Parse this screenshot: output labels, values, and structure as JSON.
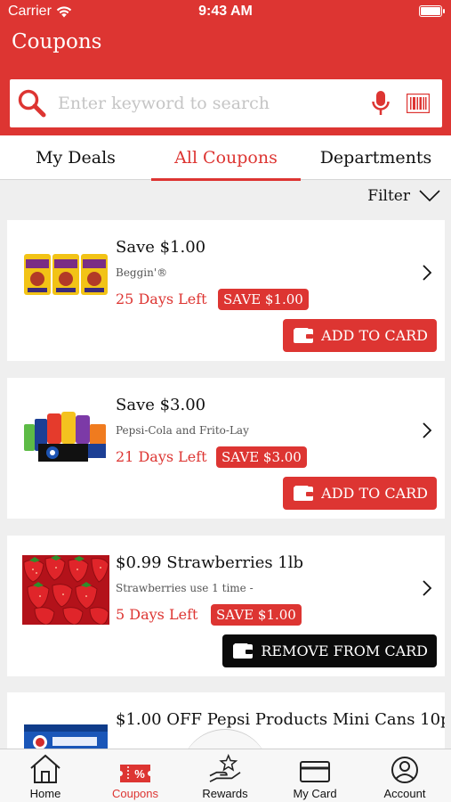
{
  "status_bar": {
    "carrier": "Carrier",
    "time": "9:43 AM"
  },
  "header": {
    "title": "Coupons"
  },
  "search": {
    "placeholder": "Enter keyword to search"
  },
  "tabs": [
    {
      "label": "My Deals",
      "active": false
    },
    {
      "label": "All Coupons",
      "active": true
    },
    {
      "label": "Departments",
      "active": false
    }
  ],
  "filter": {
    "label": "Filter"
  },
  "coupons": [
    {
      "title": "Save $1.00",
      "brand": "Beggin'®",
      "days_left": "25 Days Left",
      "badge": "SAVE $1.00",
      "button": "ADD TO CARD",
      "on_card": false,
      "image": "beggin-treats-image"
    },
    {
      "title": "Save $3.00",
      "brand": "Pepsi-Cola and Frito-Lay",
      "days_left": "21 Days Left",
      "badge": "SAVE $3.00",
      "button": "ADD TO CARD",
      "on_card": false,
      "image": "pepsi-frito-image"
    },
    {
      "title": "$0.99 Strawberries 1lb",
      "brand": "Strawberries use 1 time -",
      "days_left": "5 Days Left",
      "badge": "SAVE $1.00",
      "button": "REMOVE FROM CARD",
      "on_card": true,
      "image": "strawberries-image"
    },
    {
      "title": "$1.00 OFF Pepsi Products Mini Cans 10p...",
      "image": "pepsi-mini-cans-image"
    }
  ],
  "bottom_nav": [
    {
      "label": "Home",
      "icon": "home-icon",
      "active": false
    },
    {
      "label": "Coupons",
      "icon": "coupon-icon",
      "active": true
    },
    {
      "label": "Rewards",
      "icon": "rewards-icon",
      "active": false
    },
    {
      "label": "My Card",
      "icon": "card-icon",
      "active": false
    },
    {
      "label": "Account",
      "icon": "account-icon",
      "active": false
    }
  ],
  "colors": {
    "brand_red": "#dd3532",
    "remove_black": "#0b0b0b",
    "background": "#efefef"
  }
}
